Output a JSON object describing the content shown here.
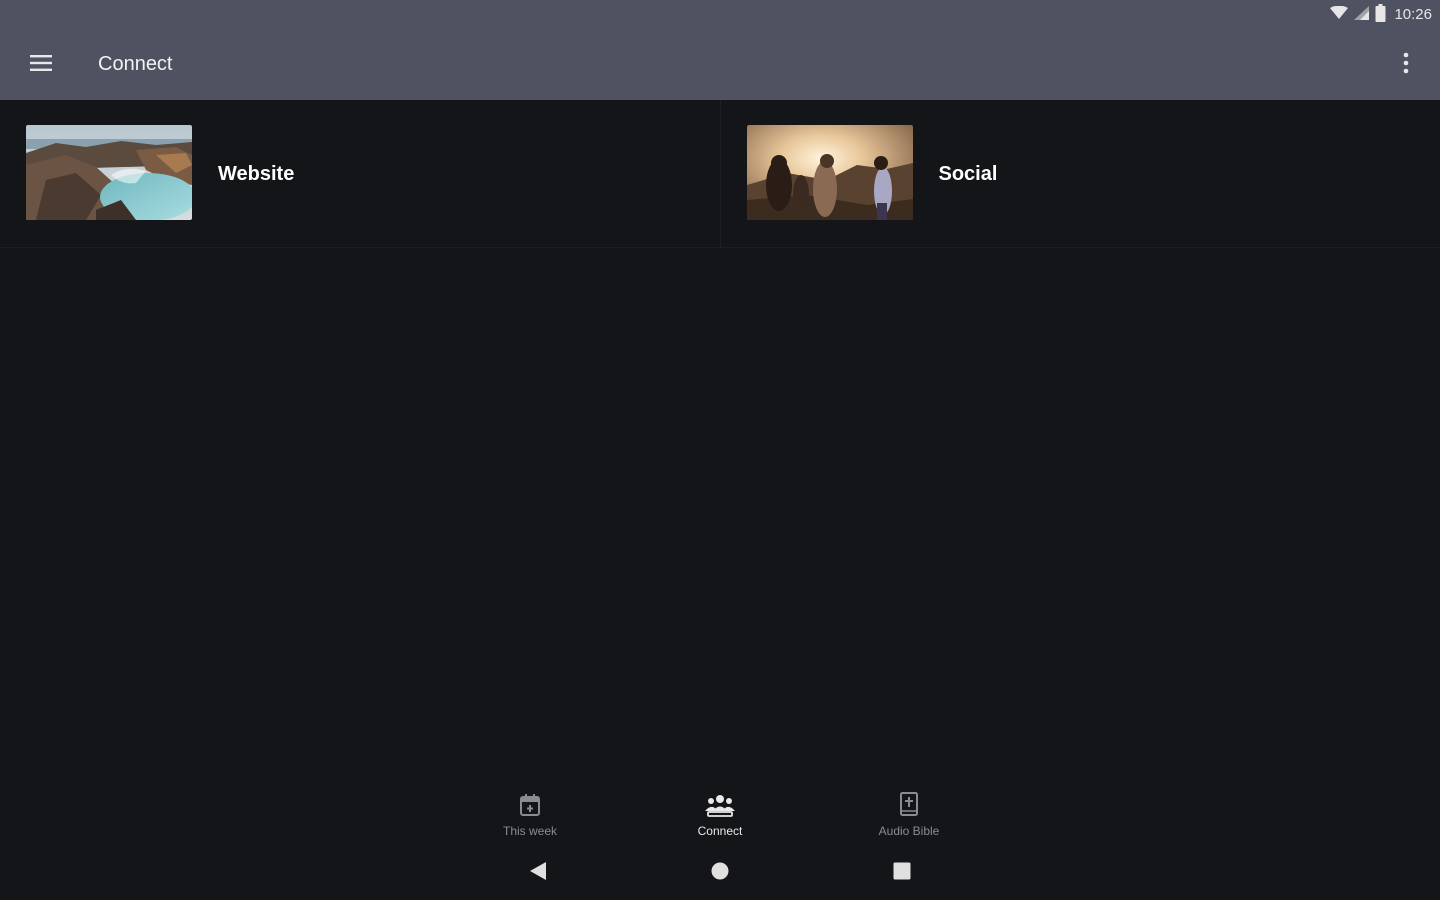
{
  "status_bar": {
    "time": "10:26",
    "icons": [
      "wifi-icon",
      "signal-icon",
      "battery-icon"
    ]
  },
  "app_bar": {
    "title": "Connect",
    "menu_icon": "hamburger-menu-icon",
    "overflow_icon": "more-vert-icon"
  },
  "cards": [
    {
      "label": "Website",
      "image": "coastal-cliffs-lagoon-photo"
    },
    {
      "label": "Social",
      "image": "friends-at-sunset-photo"
    }
  ],
  "bottom_nav": {
    "items": [
      {
        "label": "This week",
        "icon": "calendar-icon",
        "active": false
      },
      {
        "label": "Connect",
        "icon": "people-group-icon",
        "active": true
      },
      {
        "label": "Audio Bible",
        "icon": "bible-icon",
        "active": false
      }
    ]
  },
  "system_nav": {
    "icons": [
      "back-triangle-icon",
      "home-circle-icon",
      "recents-square-icon"
    ]
  },
  "colors": {
    "app_bar_bg": "#4f5361",
    "content_bg": "#141518",
    "text_primary": "#ffffff",
    "nav_inactive": "#8a8c92"
  }
}
